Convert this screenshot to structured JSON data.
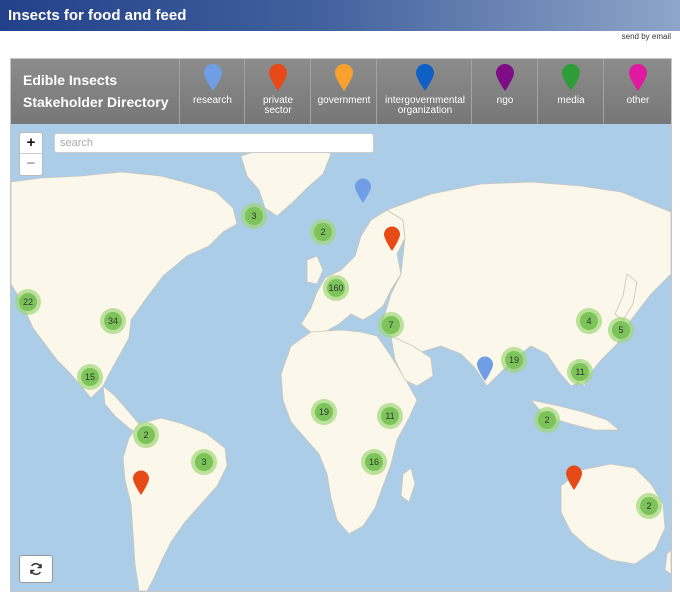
{
  "app": {
    "title": "Insects for food and feed",
    "email_link": "send by email"
  },
  "directory": {
    "title_line1": "Edible Insects",
    "title_line2": "Stakeholder Directory"
  },
  "categories": [
    {
      "label": "research",
      "color": "#6f9ee6"
    },
    {
      "label": "private sector",
      "color": "#e64a17"
    },
    {
      "label": "government",
      "color": "#f8a22d"
    },
    {
      "label": "intergovernmental organization",
      "color": "#0f5fc4"
    },
    {
      "label": "ngo",
      "color": "#7d0c86"
    },
    {
      "label": "media",
      "color": "#2e9c37"
    },
    {
      "label": "other",
      "color": "#e01aa0"
    }
  ],
  "map": {
    "search_placeholder": "search",
    "zoom_in_label": "+",
    "zoom_out_label": "−",
    "clusters": [
      {
        "region": "Iceland",
        "count": "3"
      },
      {
        "region": "Scandinavia",
        "count": "2"
      },
      {
        "region": "Europe",
        "count": "160"
      },
      {
        "region": "Western USA",
        "count": "22"
      },
      {
        "region": "Eastern USA",
        "count": "34"
      },
      {
        "region": "Mexico",
        "count": "15"
      },
      {
        "region": "Middle East",
        "count": "7"
      },
      {
        "region": "China",
        "count": "4"
      },
      {
        "region": "Japan",
        "count": "5"
      },
      {
        "region": "South Asia",
        "count": "19"
      },
      {
        "region": "Southeast Asia",
        "count": "11"
      },
      {
        "region": "Indonesia",
        "count": "2"
      },
      {
        "region": "West Africa",
        "count": "19"
      },
      {
        "region": "East Africa",
        "count": "11"
      },
      {
        "region": "Southern Africa",
        "count": "16"
      },
      {
        "region": "Peru",
        "count": "2"
      },
      {
        "region": "Brazil",
        "count": "3"
      },
      {
        "region": "Australia",
        "count": "2"
      }
    ],
    "pins": [
      {
        "region": "Finland",
        "category": "research",
        "color": "#6f9ee6"
      },
      {
        "region": "Russia",
        "category": "private sector",
        "color": "#e64a17"
      },
      {
        "region": "India",
        "category": "research",
        "color": "#6f9ee6"
      },
      {
        "region": "Chile",
        "category": "private sector",
        "color": "#e64a17"
      },
      {
        "region": "Western Australia",
        "category": "private sector",
        "color": "#e64a17"
      }
    ]
  }
}
